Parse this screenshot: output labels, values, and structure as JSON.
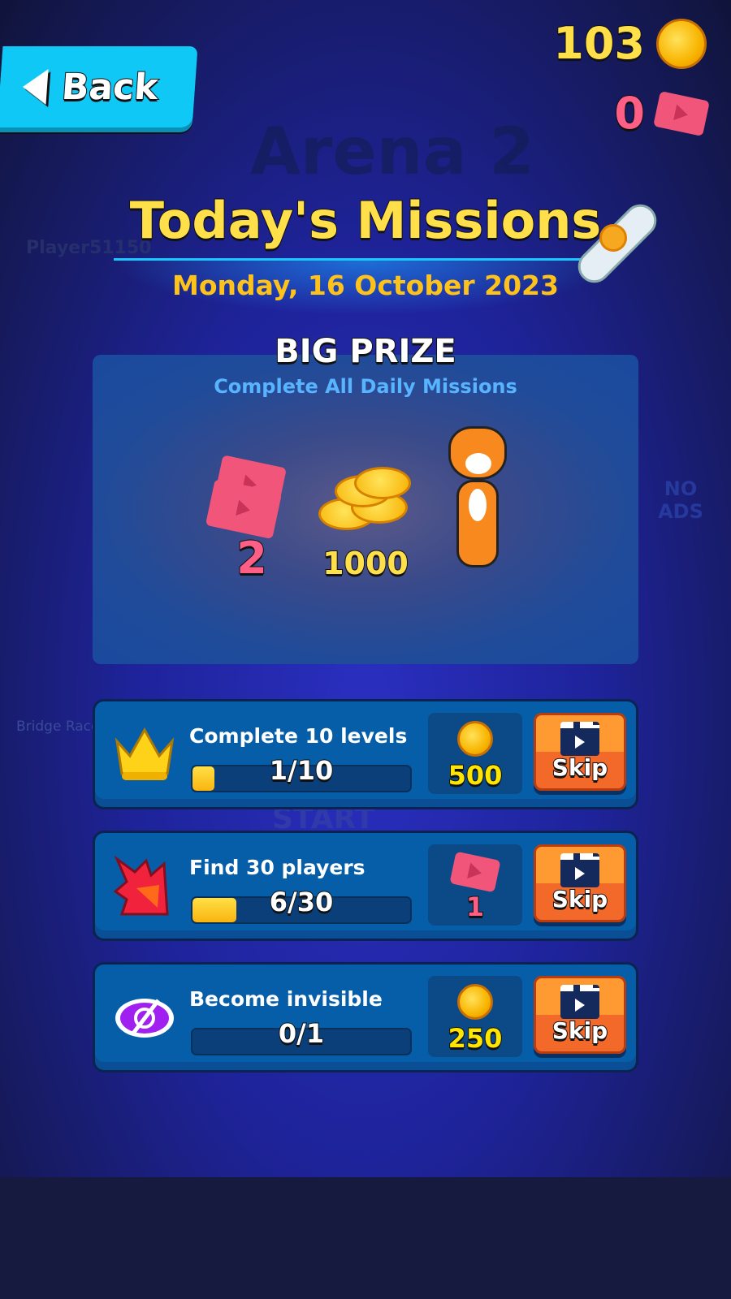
{
  "background": {
    "arena": "Arena 2",
    "player": "Player51150",
    "mode": "Bridge Race",
    "no_ads": "NO ADS",
    "start": "START"
  },
  "header": {
    "back_label": "Back",
    "coins": "103",
    "tickets": "0"
  },
  "title": "Today's Missions",
  "date": "Monday, 16 October 2023",
  "big_prize": {
    "title": "BIG PRIZE",
    "subtitle": "Complete All Daily Missions",
    "tickets": "2",
    "coins": "1000"
  },
  "missions": [
    {
      "name": "Complete 10 levels",
      "progress": "1/10",
      "fraction": 0.1,
      "reward": "500",
      "reward_type": "coin",
      "icon": "crown-icon",
      "skip": "Skip"
    },
    {
      "name": "Find 30 players",
      "progress": "6/30",
      "fraction": 0.2,
      "reward": "1",
      "reward_type": "ticket",
      "icon": "burst-icon",
      "skip": "Skip"
    },
    {
      "name": "Become invisible",
      "progress": "0/1",
      "fraction": 0,
      "reward": "250",
      "reward_type": "coin",
      "icon": "eye-slash-icon",
      "skip": "Skip"
    }
  ],
  "colors": {
    "coin_text": "#ffe04a",
    "ticket_text": "#ff5f86",
    "accent": "#10c8f5"
  }
}
